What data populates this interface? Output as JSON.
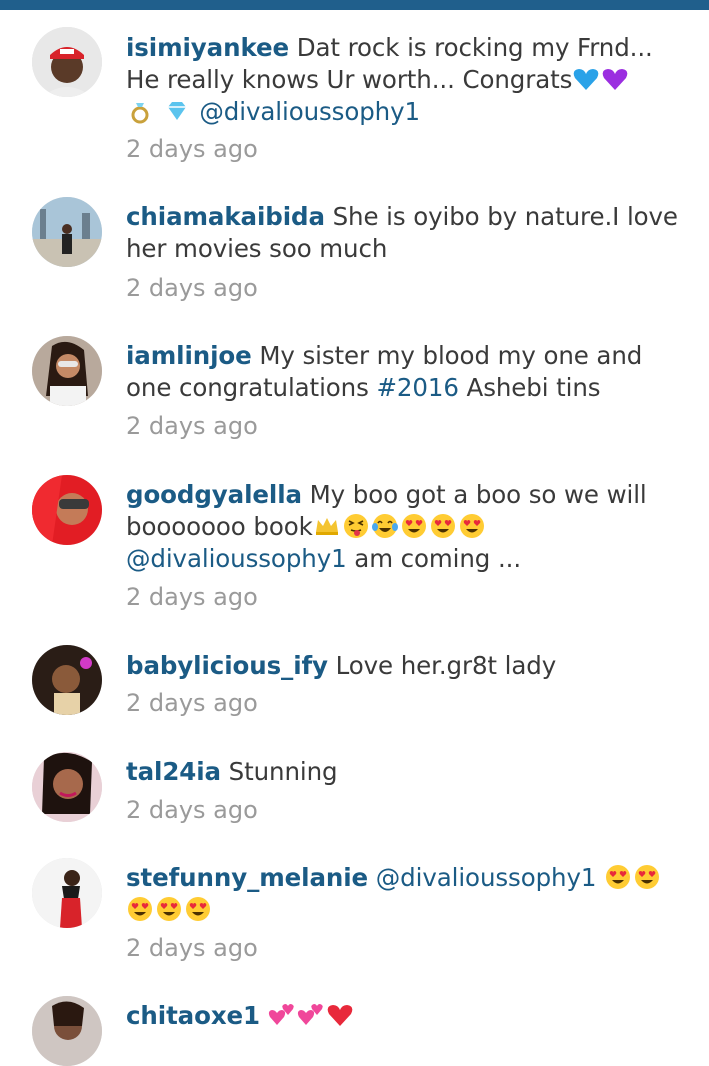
{
  "comments": [
    {
      "username": "isimiyankee",
      "line1": "Dat rock is rocking my Frnd...",
      "line2": "He really knows Ur worth... Congrats",
      "line2_emoji": [
        "blue-heart-icon",
        "purple-heart-icon"
      ],
      "line3_emoji": [
        "ring-icon",
        "gem-icon"
      ],
      "mention": "@divalioussophy1",
      "time": "2 days ago"
    },
    {
      "username": "chiamakaibida",
      "line1": "She is oyibo by nature.I love",
      "line2": "her movies soo much",
      "time": "2 days ago"
    },
    {
      "username": "iamlinjoe",
      "line1": "My sister my blood my one and",
      "line2_pre": "one congratulations ",
      "hashtag": "#2016",
      "line2_post": " Ashebi tins",
      "time": "2 days ago"
    },
    {
      "username": "goodgyalella",
      "line1": "My boo got a boo so we will",
      "line2": "booooooo book",
      "line2_emoji": [
        "crown-icon",
        "squint-tongue-face-icon",
        "tears-of-joy-face-icon",
        "heart-eyes-face-icon",
        "heart-eyes-face-icon",
        "heart-eyes-face-icon"
      ],
      "mention": "@divalioussophy1",
      "line3_post": " am coming ...",
      "time": "2 days ago"
    },
    {
      "username": "babylicious_ify",
      "line1": "Love her.gr8t lady",
      "time": "2 days ago"
    },
    {
      "username": "tal24ia",
      "line1": "Stunning",
      "time": "2 days ago"
    },
    {
      "username": "stefunny_melanie",
      "mention": "@divalioussophy1",
      "line1_emoji": [
        "heart-eyes-face-icon",
        "heart-eyes-face-icon"
      ],
      "line2_emoji": [
        "heart-eyes-face-icon",
        "heart-eyes-face-icon",
        "heart-eyes-face-icon"
      ],
      "time": "2 days ago"
    },
    {
      "username": "chitaoxe1",
      "line1_emoji": [
        "two-hearts-icon",
        "two-hearts-icon",
        "red-heart-icon"
      ]
    }
  ],
  "colors": {
    "accent": "#1b5b85",
    "topbar": "#205f8c",
    "text": "#3a3a3a",
    "timestamp": "#9a9a9a"
  }
}
